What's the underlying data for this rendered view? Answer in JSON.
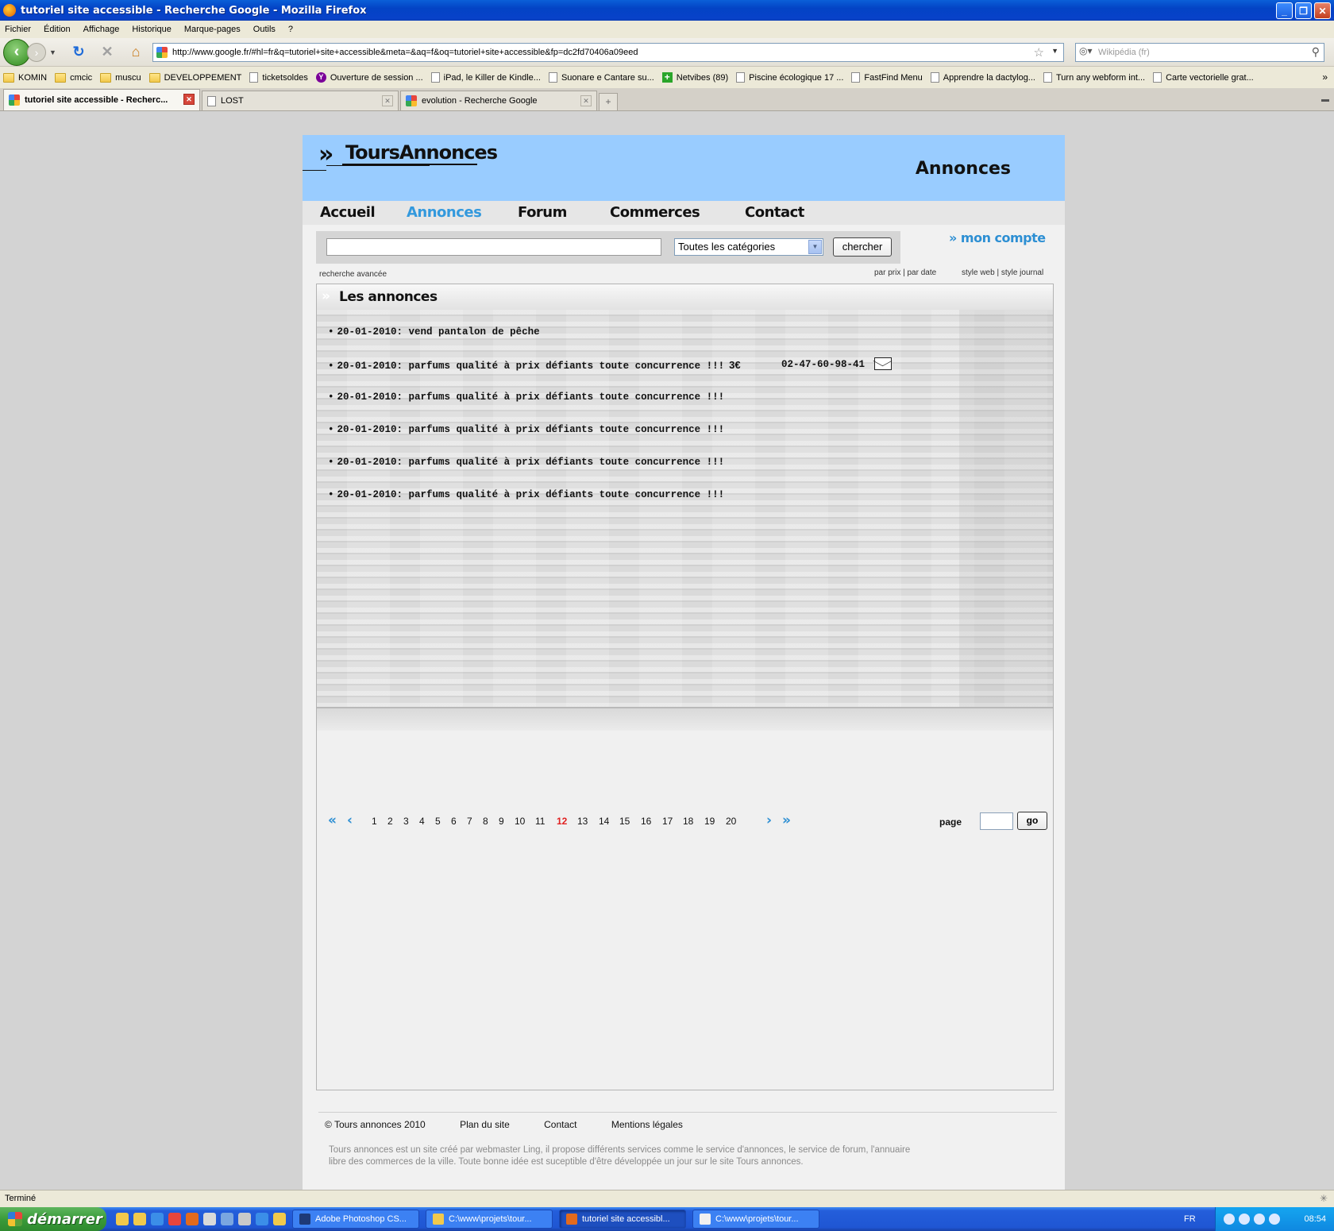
{
  "window": {
    "title": "tutoriel site accessible - Recherche Google - Mozilla Firefox"
  },
  "menu": [
    "Fichier",
    "Édition",
    "Affichage",
    "Historique",
    "Marque-pages",
    "Outils",
    "?"
  ],
  "toolbar": {
    "url": "http://www.google.fr/#hl=fr&q=tutoriel+site+accessible&meta=&aq=f&oq=tutoriel+site+accessible&fp=dc2fd70406a09eed",
    "search_placeholder": "Wikipédia (fr)"
  },
  "bookmarks": [
    {
      "label": "KOMIN",
      "icon": "folder-icon"
    },
    {
      "label": "cmcic",
      "icon": "folder-icon"
    },
    {
      "label": "muscu",
      "icon": "folder-icon"
    },
    {
      "label": "DEVELOPPEMENT",
      "icon": "folder-icon"
    },
    {
      "label": "ticketsoldes",
      "icon": "page-icon"
    },
    {
      "label": "Ouverture de session ...",
      "icon": "yahoo-icon"
    },
    {
      "label": "iPad, le Killer de Kindle...",
      "icon": "page-icon"
    },
    {
      "label": "Suonare e Cantare su...",
      "icon": "page-icon"
    },
    {
      "label": "Netvibes (89)",
      "icon": "plus-icon"
    },
    {
      "label": "Piscine écologique 17 ...",
      "icon": "page-icon"
    },
    {
      "label": "FastFind Menu",
      "icon": "page-icon"
    },
    {
      "label": "Apprendre la dactylog...",
      "icon": "page-icon"
    },
    {
      "label": "Turn any webform int...",
      "icon": "page-icon"
    },
    {
      "label": "Carte vectorielle grat...",
      "icon": "page-icon"
    }
  ],
  "tabs": [
    {
      "label": "tutoriel site accessible - Recherc...",
      "active": true
    },
    {
      "label": "LOST",
      "active": false
    },
    {
      "label": "evolution - Recherche Google",
      "active": false
    }
  ],
  "site": {
    "logo": "ToursAnnonces",
    "section_title": "Annonces",
    "nav": [
      "Accueil",
      "Annonces",
      "Forum",
      "Commerces",
      "Contact"
    ],
    "nav_current": "Annonces",
    "search": {
      "query": "",
      "category": "Toutes les catégories",
      "button": "chercher"
    },
    "account_link": "mon compte",
    "advanced_search": "recherche avancée",
    "sort_links": "par prix | par date",
    "style_links": "style web | style journal",
    "box_title": "Les annonces",
    "listings": [
      {
        "date": "20-01-2010:",
        "title": "vend pantalon de pêche",
        "price": "",
        "phone": ""
      },
      {
        "date": "20-01-2010:",
        "title": "parfums qualité à prix défiants toute concurrence !!!",
        "price": "3€",
        "phone": "02-47-60-98-41"
      },
      {
        "date": "20-01-2010:",
        "title": "parfums qualité à prix défiants toute concurrence !!!",
        "price": "",
        "phone": ""
      },
      {
        "date": "20-01-2010:",
        "title": "parfums qualité à prix défiants toute concurrence !!!",
        "price": "",
        "phone": ""
      },
      {
        "date": "20-01-2010:",
        "title": "parfums qualité à prix défiants toute concurrence !!!",
        "price": "",
        "phone": ""
      },
      {
        "date": "20-01-2010:",
        "title": "parfums qualité à prix défiants toute concurrence !!!",
        "price": "",
        "phone": ""
      }
    ],
    "pagination": {
      "pages": [
        "1",
        "2",
        "3",
        "4",
        "5",
        "6",
        "7",
        "8",
        "9",
        "10",
        "11",
        "12",
        "13",
        "14",
        "15",
        "16",
        "17",
        "18",
        "19",
        "20"
      ],
      "current": "12",
      "first": "«",
      "prev": "‹",
      "next": "›",
      "last": "»",
      "page_label": "page",
      "go_label": "go"
    },
    "footer": {
      "copyright": "© Tours annonces 2010",
      "links": [
        "Plan du site",
        "Contact",
        "Mentions légales"
      ],
      "text": "Tours annonces est un site créé par webmaster Ling, il propose différents services comme le service d'annonces, le service de forum, l'annuaire libre des commerces de la ville. Toute bonne idée est suceptible d'être développée un jour sur le site Tours annonces."
    }
  },
  "status": "Terminé",
  "taskbar": {
    "start": "démarrer",
    "tasks": [
      {
        "label": "Adobe Photoshop CS...",
        "active": false
      },
      {
        "label": "C:\\www\\projets\\tour...",
        "active": false
      },
      {
        "label": "tutoriel site accessibl...",
        "active": true
      },
      {
        "label": "C:\\www\\projets\\tour...",
        "active": false
      }
    ],
    "lang": "FR",
    "clock": "08:54"
  },
  "colors": {
    "header_bg": "#99ccff",
    "accent": "#2d8fd3",
    "current_page": "#e02020"
  }
}
